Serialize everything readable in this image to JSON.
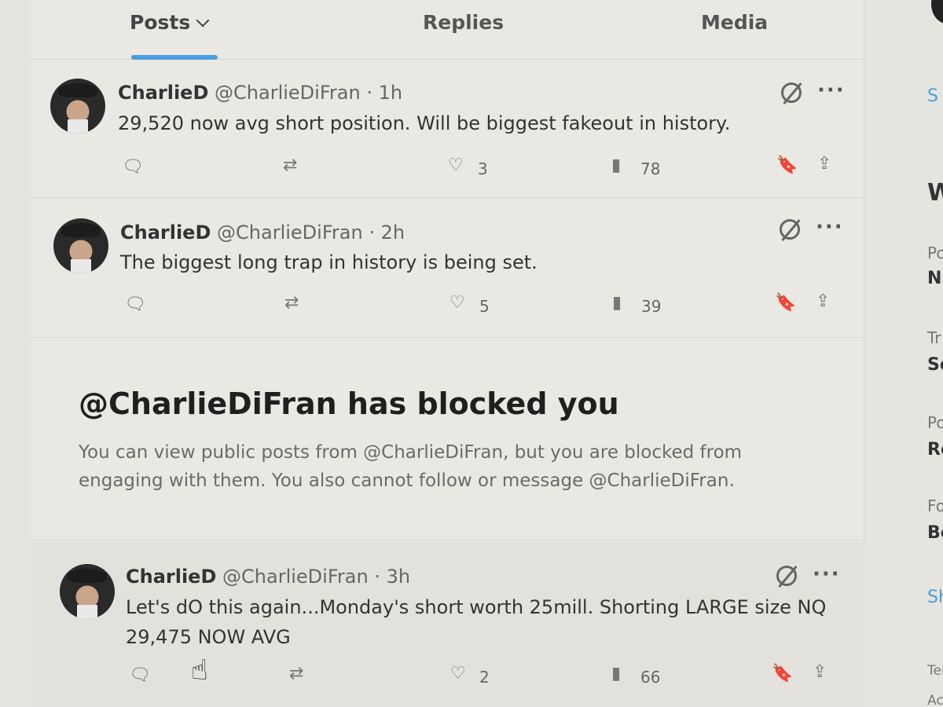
{
  "tabs": [
    {
      "label": "Posts"
    },
    {
      "label": "Replies"
    },
    {
      "label": "Media"
    }
  ],
  "posts": [
    {
      "name": "CharlieD",
      "handle": "@CharlieDiFran",
      "time": "1h",
      "text": "29,520 now avg short position. Will be biggest fakeout in history.",
      "likes": "3",
      "views": "78"
    },
    {
      "name": "CharlieD",
      "handle": "@CharlieDiFran",
      "time": "2h",
      "text": "The biggest long trap in history is being set.",
      "likes": "5",
      "views": "39"
    },
    {
      "name": "CharlieD",
      "handle": "@CharlieDiFran",
      "time": "3h",
      "text_line1": "Let's dO this again...Monday's short worth 25mill. Shorting LARGE size NQ",
      "text_line2": "29,475 NOW AVG",
      "likes": "2",
      "views": "66"
    }
  ],
  "blocked": {
    "title": "@CharlieDiFran has blocked you",
    "line1": "You can view public posts from @CharlieDiFran, but you are blocked from",
    "line2": "engaging with them. You also cannot follow or message @CharlieDiFran."
  },
  "sidebar": {
    "s1": "S",
    "w": "W",
    "p1": "Po",
    "n": "N",
    "tr": "Tr",
    "s2": "Se",
    "p2": "Po",
    "r": "Re",
    "fo": "Fo",
    "bo": "Bo",
    "sh": "Sh",
    "ter": "Ter",
    "acc": "Acc"
  },
  "icons": [
    "reply-icon",
    "repost-icon",
    "like-icon",
    "views-icon",
    "bookmark-icon",
    "share-icon",
    "grok-icon",
    "more-icon",
    "chevron-down-icon",
    "hand-cursor-icon"
  ],
  "colors": {
    "accent": "#4b9edb",
    "background": "#eae8e3",
    "text": "#333333",
    "muted": "#666666"
  }
}
